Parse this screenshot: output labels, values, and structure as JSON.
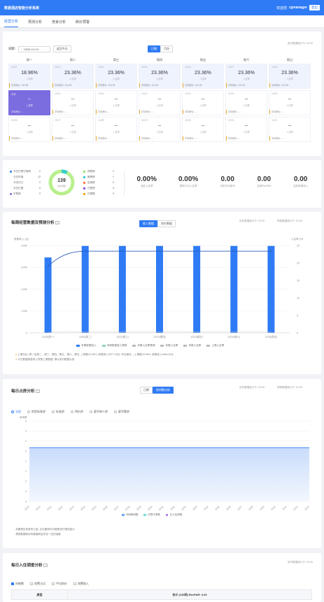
{
  "app": {
    "title": "数据酒店智能分析系统",
    "welcome": "欢迎您",
    "user": "rgmanager",
    "logout": "登出"
  },
  "nav": {
    "tabs": [
      "经营分析",
      "预测分析",
      "竞争分析",
      "刷价预警"
    ]
  },
  "calendar": {
    "date_label": "日期:",
    "date_value": "2020-10-19",
    "prev_week": "返回今天",
    "mode_day": "日期",
    "mode_month": "月份",
    "update_time": "实时数据统计于: 02:00",
    "weekdays": [
      "周一",
      "周二",
      "周三",
      "周四",
      "周五",
      "周六",
      "周日"
    ],
    "row1": [
      {
        "date": "10/12",
        "pct": "18.96%",
        "sub": "入住率",
        "avg": "平均房价: 132.85"
      },
      {
        "date": "10/13",
        "pct": "23.36%",
        "sub": "入住率",
        "avg": "平均房价: 124.29"
      },
      {
        "date": "10/14",
        "pct": "23.36%",
        "sub": "入住率",
        "avg": "平均房价: 124.29"
      },
      {
        "date": "10/15",
        "pct": "23.36%",
        "sub": "入住率",
        "avg": "平均房价: 124.29"
      },
      {
        "date": "10/16",
        "pct": "23.36%",
        "sub": "入住率",
        "avg": "平均房价: 124.29"
      },
      {
        "date": "10/17",
        "pct": "23.36%",
        "sub": "入住率",
        "avg": "平均房价: 124.29"
      },
      {
        "date": "10/18",
        "pct": "23.36%",
        "sub": "入住率",
        "avg": "平均房价: 124.29"
      }
    ],
    "row2": [
      {
        "date": "今天",
        "pct": "--",
        "sub": "入住率",
        "avg": "平均房价: --"
      },
      {
        "date": "10/20",
        "pct": "--",
        "sub": "入住率",
        "avg": "平均房价: --"
      },
      {
        "date": "10/21",
        "pct": "--",
        "sub": "入住率",
        "avg": "平均房价: --"
      },
      {
        "date": "10/22",
        "pct": "--",
        "sub": "入住率",
        "avg": "平均房价: --"
      },
      {
        "date": "10/23",
        "pct": "--",
        "sub": "入住率",
        "avg": "平均房价: --"
      },
      {
        "date": "10/24",
        "pct": "--",
        "sub": "入住率",
        "avg": "平均房价: --"
      },
      {
        "date": "10/25",
        "pct": "--",
        "sub": "入住率",
        "avg": "平均房价: --"
      }
    ],
    "row3": [
      {
        "date": "10/26",
        "pct": "--",
        "sub": "入住率",
        "avg": "平均房价: --"
      },
      {
        "date": "10/27",
        "pct": "--",
        "sub": "入住率",
        "avg": "平均房价: --"
      },
      {
        "date": "10/28",
        "pct": "--",
        "sub": "入住率",
        "avg": "平均房价: --"
      },
      {
        "date": "10/29",
        "pct": "--",
        "sub": "入住率",
        "avg": "平均房价: --"
      },
      {
        "date": "10/30",
        "pct": "--",
        "sub": "入住率",
        "avg": "平均房价: --"
      },
      {
        "date": "10/31",
        "pct": "--",
        "sub": "入住率",
        "avg": "平均房价: --"
      },
      {
        "date": "11/01",
        "pct": "--",
        "sub": "入住率",
        "avg": "平均房价: --"
      }
    ]
  },
  "status": {
    "left_items": [
      {
        "label": "今日已预订房间",
        "value": "0",
        "color": "#2f7bf5"
      },
      {
        "label": "今日可用",
        "value": "12",
        "color": "#2f7bf5"
      },
      {
        "label": "今日已订",
        "value": "0",
        "color": "#2f7bf5"
      },
      {
        "label": "今日已退",
        "value": "0",
        "color": "#2f7bf5"
      },
      {
        "label": "可售房",
        "value": "0",
        "color": "#7b6ce0"
      }
    ],
    "donut_value": "139",
    "donut_label": "总房间数",
    "right_items": [
      {
        "label": "停售房",
        "value": "2",
        "color": "#9be36b"
      },
      {
        "label": "维修房",
        "value": "1",
        "color": "#36cfc9"
      },
      {
        "label": "自用房",
        "value": "0",
        "color": "#ff7a45"
      },
      {
        "label": "已售房",
        "value": "0",
        "color": "#9254de"
      },
      {
        "label": "已预离",
        "value": "0",
        "color": "#f5a623"
      }
    ],
    "stats": [
      {
        "value": "0.00%",
        "label": "当前入住率"
      },
      {
        "value": "0.00%",
        "label": "预测今日入住率"
      },
      {
        "value": "0.00",
        "label": "当前平均房价"
      },
      {
        "value": "0.00",
        "label": "当前RevPAR"
      },
      {
        "value": "0.00",
        "label": "当前房费收入"
      }
    ]
  },
  "weekly": {
    "title": "每周经营数据及预测分析",
    "tab_on": "收入数据",
    "tab_off": "房价数据",
    "update1": "实时数据统计于: 02:00",
    "update2": "预测数据统计于: 02:00",
    "yleft_label": "房费收入 (元)",
    "yright_label": "入住率 (%)",
    "notes": [
      "上周对比: 周一至周二、周三、周四、周五、周六、周日, 上周数23.36%, 房费收入3977.20元; 环比增长--, 上周数18.96%, 房费收入3454.20元",
      "今日数据房费收入须是上周数据, 请以实时数据为准"
    ],
    "legend": [
      "本周房费收入",
      "本周房费收入预测",
      "本周入住率预测",
      "本周入住率",
      "本周入住率",
      "上周入住率"
    ]
  },
  "weekly_chart_data": {
    "type": "bar",
    "categories": [
      "10/19(周一)",
      "10/20(周二)",
      "10/21(周三)",
      "10/22(周四)",
      "10/23(周五)",
      "10/24(周六)",
      "10/25(周日)"
    ],
    "yleft_ticks": [
      "4,000",
      "3,000",
      "2,000",
      "1,000",
      "0"
    ],
    "yright_ticks": [
      "25",
      "20",
      "15",
      "10",
      "5",
      "0"
    ],
    "ylim": [
      0,
      4000
    ],
    "y2lim": [
      0,
      25
    ],
    "series": [
      {
        "name": "本周房费收入",
        "values": [
          3450,
          3977,
          3977,
          3977,
          3977,
          3977,
          3977
        ],
        "color": "#2f7bf5"
      },
      {
        "name": "本周入住率预测",
        "values": [
          18.96,
          23.36,
          23.36,
          23.36,
          23.36,
          23.36,
          23.36
        ],
        "color": "#2f5fb8"
      }
    ]
  },
  "daily": {
    "title": "每日占房分析",
    "tab_off": "日期",
    "tab_on": "房间数分析",
    "update1": "实时数据统计于: 02:00",
    "update2": "预测数据统计于: 02:00",
    "options": [
      "全部",
      "房型标准房",
      "标准房",
      "特价房",
      "豪华单人房",
      "豪华套房"
    ],
    "y_label": "房间数",
    "y_ticks": [
      "3",
      "3",
      "2",
      "2",
      "1",
      "1",
      "0",
      "0",
      "0"
    ],
    "x_ticks": [
      "10/19",
      "10/20",
      "10/21",
      "10/22",
      "10/23",
      "10/24",
      "10/25",
      "10/26",
      "10/27",
      "10/28",
      "10/29",
      "10/30",
      "10/31",
      "11/01",
      "11/02",
      "11/03",
      "11/04",
      "11/05",
      "11/06",
      "11/07",
      "11/08",
      "11/09",
      "11/10",
      "11/11",
      "11/12",
      "11/13"
    ],
    "legend": [
      "可用房间数",
      "已预订房数",
      "已入住房数"
    ],
    "notes": [
      "- 本图表仅供参考之用, 点击图例可对图表进行筛选显示",
      "- 预测数据和实际数据间会存在一定的误差"
    ]
  },
  "daily_chart_data": {
    "type": "area",
    "series": [
      {
        "name": "可用房间数",
        "value": 2,
        "color": "#2f7bf5"
      }
    ],
    "ylim": [
      0,
      3
    ]
  },
  "occupancy": {
    "title": "每日入住调查分析",
    "update": "实时数据统计于: 02:00",
    "options": [
      "间夜数",
      "房费占比",
      "平均房价",
      "房费收入"
    ],
    "table_header": [
      "房型",
      "合计 (139间) RevPAR: 0.00"
    ]
  }
}
